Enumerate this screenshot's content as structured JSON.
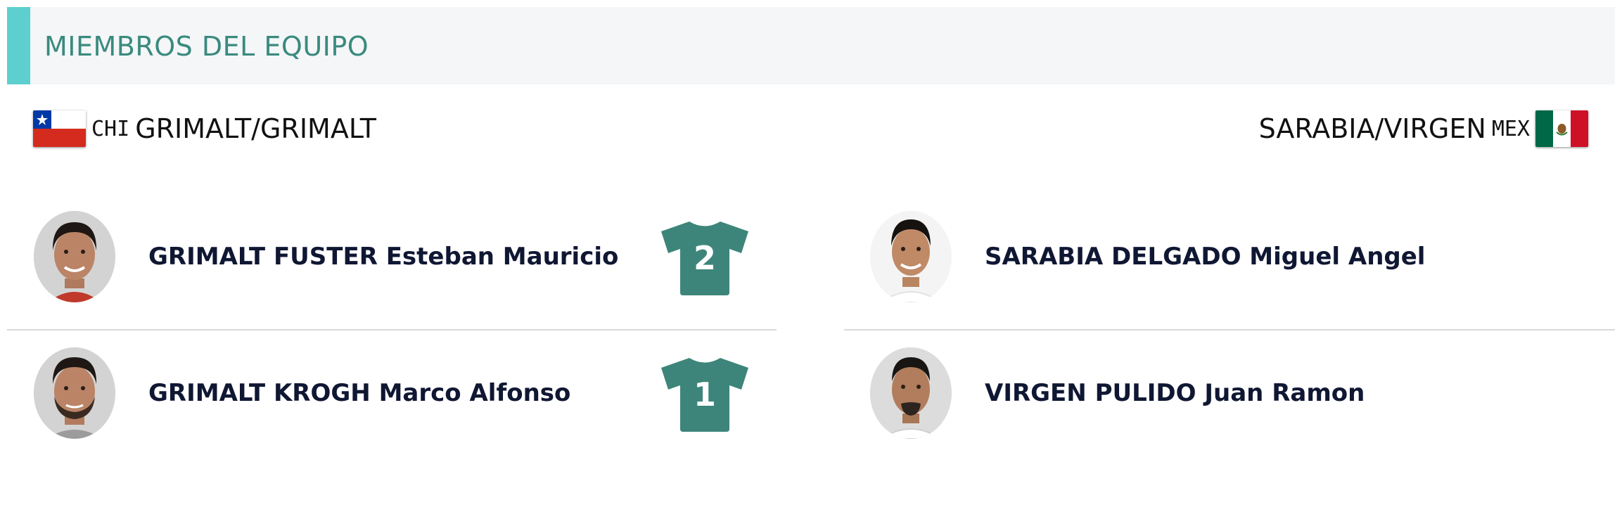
{
  "section": {
    "title": "MIEMBROS DEL EQUIPO"
  },
  "teams": [
    {
      "code": "CHI",
      "name": "GRIMALT/GRIMALT",
      "flag": "chile-flag",
      "players": [
        {
          "name": "GRIMALT FUSTER Esteban Mauricio",
          "number": "2"
        },
        {
          "name": "GRIMALT KROGH Marco Alfonso",
          "number": "1"
        }
      ]
    },
    {
      "code": "MEX",
      "name": "SARABIA/VIRGEN",
      "flag": "mexico-flag",
      "players": [
        {
          "name": "SARABIA DELGADO Miguel Angel"
        },
        {
          "name": "VIRGEN PULIDO Juan Ramon"
        }
      ]
    }
  ],
  "colors": {
    "accent": "#5dcfcf",
    "title": "#3a8a7e",
    "jersey": "#3d857a",
    "header_bg": "#f4f6f8"
  },
  "icons": {
    "jersey": "jersey-icon"
  }
}
